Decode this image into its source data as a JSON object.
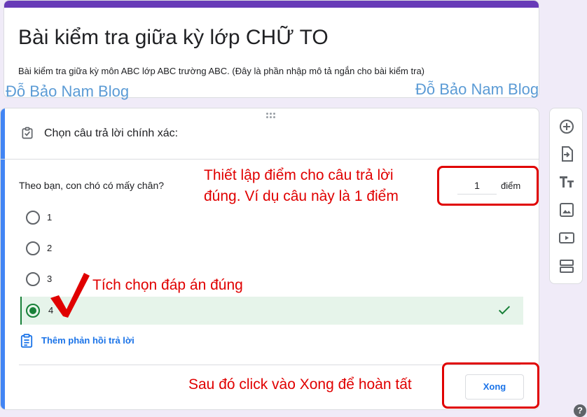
{
  "form": {
    "title": "Bài kiểm tra giữa kỳ lớp CHỮ TO",
    "description": "Bài kiểm tra giữa kỳ môn ABC lớp ABC trường ABC. (Đây là phần nhập mô tả ngắn cho bài kiểm tra)",
    "accent_color": "#673ab7"
  },
  "watermark": {
    "left": "Đỗ Bảo Nam Blog",
    "right": "Đỗ Bảo Nam Blog"
  },
  "question_card": {
    "header_label": "Chọn câu trả lời chính xác:",
    "question_text": "Theo bạn, con chó có mấy chân?",
    "points_value": "1",
    "points_unit": "điểm",
    "options": [
      {
        "label": "1",
        "correct": false
      },
      {
        "label": "2",
        "correct": false
      },
      {
        "label": "3",
        "correct": false
      },
      {
        "label": "4",
        "correct": true
      }
    ],
    "feedback_link": "Thêm phản hồi trả lời",
    "done_button": "Xong",
    "correct_color": "#188038"
  },
  "toolbar": {
    "tools": [
      "add-question-icon",
      "import-questions-icon",
      "add-title-icon",
      "add-image-icon",
      "add-video-icon",
      "add-section-icon"
    ]
  },
  "annotations": {
    "points_note_line1": "Thiết lập điểm cho câu trả lời",
    "points_note_line2": "đúng. Ví dụ câu này là 1 điểm",
    "answer_note": "Tích chọn đáp án đúng",
    "done_note": "Sau đó click vào Xong để hoàn tất",
    "color": "#e00000"
  },
  "help": {
    "label": "?"
  }
}
